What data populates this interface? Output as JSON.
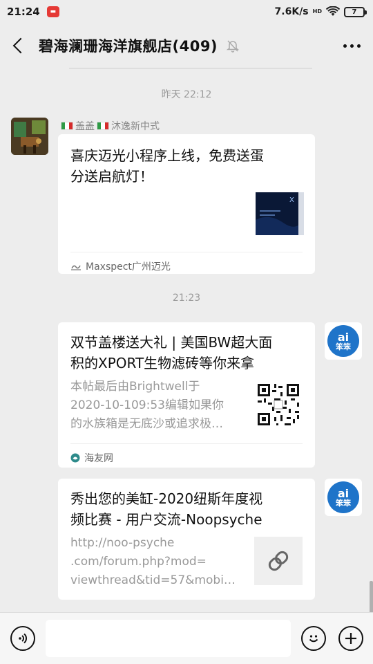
{
  "status_bar": {
    "time": "21:24",
    "app_badge": "",
    "network_speed": "7.6K/s",
    "network_type": "HD",
    "battery": "7"
  },
  "nav": {
    "title": "碧海澜珊海洋旗舰店(409)"
  },
  "messages": {
    "ts1": "昨天 22:12",
    "msg1": {
      "sender": "盖盖",
      "sender_suffix": "沐逸新中式",
      "title_line1": "喜庆迈光小程序上线，免费送蛋",
      "title_line2": "分送启航灯！",
      "source": "Maxspect广州迈光",
      "thumb_letter": "X"
    },
    "ts2": "21:23",
    "msg2": {
      "title_line1": "双节盖楼送大礼 | 美国BW超大面",
      "title_line2": "积的XPORT生物滤砖等你来拿",
      "desc_line1": "本帖最后由Brightwell于",
      "desc_line2": "2020-10-109:53编辑如果你",
      "desc_line3": "的水族箱是无底沙或追求极…",
      "source": "海友网"
    },
    "msg3": {
      "title_line1": "秀出您的美缸-2020纽斯年度视",
      "title_line2": "频比赛 - 用户交流-Noopsyche",
      "desc_line1": "http://noo-psyche",
      "desc_line2": ".com/forum.php?mod=",
      "desc_line3": "viewthread&tid=57&mobi…"
    },
    "avatar_right": {
      "top": "ai",
      "bottom": "笨笨"
    }
  },
  "colors": {
    "background": "#ededed",
    "bubble": "#ffffff",
    "avatar_blue": "#1f74c9",
    "timestamp": "#9a9a9a"
  },
  "icons": [
    "back-arrow-icon",
    "mute-bell-icon",
    "more-icon",
    "voice-icon",
    "emoji-icon",
    "plus-icon",
    "link-icon",
    "mini-program-icon",
    "website-icon"
  ]
}
